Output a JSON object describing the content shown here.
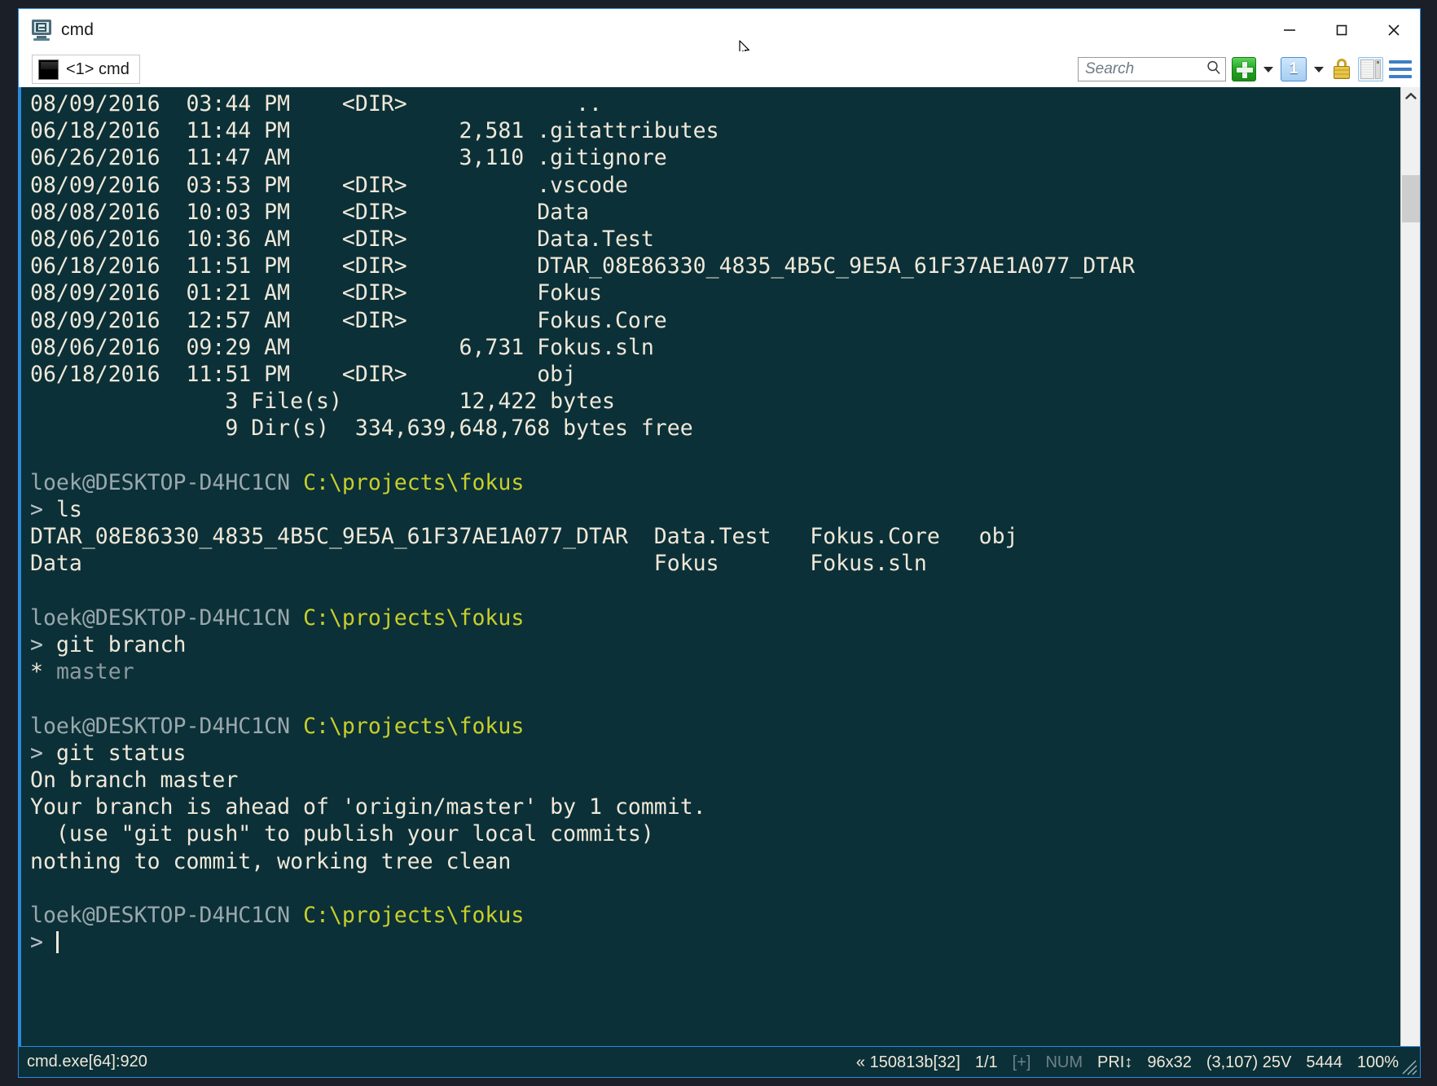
{
  "window": {
    "title": "cmd",
    "app_icon": "console-app-icon",
    "minimize_label": "Minimize",
    "maximize_label": "Maximize",
    "close_label": "Close"
  },
  "tabs": [
    {
      "label": "<1> cmd",
      "icon": "console-tab-icon",
      "active": true
    }
  ],
  "toolbar": {
    "search": {
      "placeholder": "Search",
      "value": "",
      "icon": "search-icon"
    },
    "new_console_label": "+",
    "new_console_dropdown_label": "",
    "active_console_number": "1",
    "console_dropdown_label": "",
    "lock_label": "",
    "panel_view_label": "",
    "menu_label": ""
  },
  "console": {
    "background": "#0b3038",
    "foreground": "#f0e8d8",
    "prompt_user": "loek@DESKTOP-D4HC1CN",
    "prompt_path": "C:\\projects\\fokus",
    "prompt_char": ">",
    "colors": {
      "user": "#9aa8ad",
      "path": "#c8cf2a",
      "dim": "#8d9ba0",
      "accent": "#2b8ae0"
    },
    "dir_listing": [
      "08/09/2016  03:44 PM    <DIR>             ..",
      "06/18/2016  11:44 PM             2,581 .gitattributes",
      "06/26/2016  11:47 AM             3,110 .gitignore",
      "08/09/2016  03:53 PM    <DIR>          .vscode",
      "08/08/2016  10:03 PM    <DIR>          Data",
      "08/06/2016  10:36 AM    <DIR>          Data.Test",
      "06/18/2016  11:51 PM    <DIR>          DTAR_08E86330_4835_4B5C_9E5A_61F37AE1A077_DTAR",
      "08/09/2016  01:21 AM    <DIR>          Fokus",
      "08/09/2016  12:57 AM    <DIR>          Fokus.Core",
      "08/06/2016  09:29 AM             6,731 Fokus.sln",
      "06/18/2016  11:51 PM    <DIR>          obj",
      "               3 File(s)         12,422 bytes",
      "               9 Dir(s)  334,639,648,768 bytes free"
    ],
    "blocks": [
      {
        "command": "ls",
        "output": [
          "DTAR_08E86330_4835_4B5C_9E5A_61F37AE1A077_DTAR  Data.Test   Fokus.Core   obj",
          "Data                                            Fokus       Fokus.sln"
        ]
      },
      {
        "command": "git branch",
        "output_marker": "*",
        "output_branch": "master"
      },
      {
        "command": "git status",
        "output": [
          "On branch master",
          "Your branch is ahead of 'origin/master' by 1 commit.",
          "  (use \"git push\" to publish your local commits)",
          "nothing to commit, working tree clean"
        ]
      }
    ],
    "cursor_visible": true
  },
  "scrollbar": {
    "up_arrow": "chevron-up-icon",
    "thumb_position_pct": 18
  },
  "statusbar": {
    "process": "cmd.exe[64]:920",
    "build": "« 150813b[32]",
    "tab_index": "1/1",
    "plus_flag": "[+]",
    "num_flag": "NUM",
    "pri_flag": "PRI↕",
    "size": "96x32",
    "coords": "(3,107) 25V",
    "buffer": "5444",
    "zoom": "100%"
  }
}
